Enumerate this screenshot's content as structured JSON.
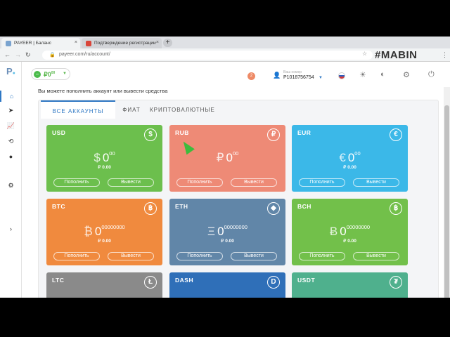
{
  "browser": {
    "tabs": [
      {
        "label": "PAYEER | Баланс",
        "active": true
      },
      {
        "label": "Подтверждение регистрации",
        "active": false
      }
    ],
    "new_tab": "+",
    "url": "payeer.com/ru/account/",
    "watermark": "#MABIN"
  },
  "app": {
    "logo": "P",
    "balance": {
      "value": "₽0",
      "decimals": "00"
    },
    "notifications": "2",
    "user": {
      "label": "Ваш номер",
      "id": "P1018756754"
    },
    "notice": "Вы можете пополнить аккаунт или вывести средства",
    "tabs": [
      {
        "label": "ВСЕ АККАУНТЫ",
        "active": true
      },
      {
        "label": "ФИАТ",
        "active": false
      },
      {
        "label": "КРИПТОВАЛЮТНЫЕ",
        "active": false
      }
    ],
    "deposit_label": "Пополнить",
    "withdraw_label": "Вывести",
    "cards": [
      {
        "code": "USD",
        "icon": "$",
        "sym": "$",
        "whole": "0",
        "dec": "00",
        "rub": "0.00",
        "color": "#6cbf4d"
      },
      {
        "code": "RUB",
        "icon": "₽",
        "sym": "₽",
        "whole": "0",
        "dec": "00",
        "rub": "",
        "color": "#ee8a76"
      },
      {
        "code": "EUR",
        "icon": "€",
        "sym": "€",
        "whole": "0",
        "dec": "00",
        "rub": "0.00",
        "color": "#3bb8e8"
      },
      {
        "code": "BTC",
        "icon": "฿",
        "sym": "₿",
        "whole": "0",
        "dec": "00000000",
        "rub": "0.00",
        "color": "#f08a3e"
      },
      {
        "code": "ETH",
        "icon": "◆",
        "sym": "Ξ",
        "whole": "0",
        "dec": "00000000",
        "rub": "0.00",
        "color": "#6186a8"
      },
      {
        "code": "BCH",
        "icon": "฿",
        "sym": "Ƀ",
        "whole": "0",
        "dec": "00000000",
        "rub": "0.00",
        "color": "#72c04a"
      },
      {
        "code": "LTC",
        "icon": "Ł",
        "color": "#8a8a8a"
      },
      {
        "code": "DASH",
        "icon": "D",
        "color": "#2f6fb8"
      },
      {
        "code": "USDT",
        "icon": "₮",
        "color": "#4fb08d"
      }
    ]
  }
}
